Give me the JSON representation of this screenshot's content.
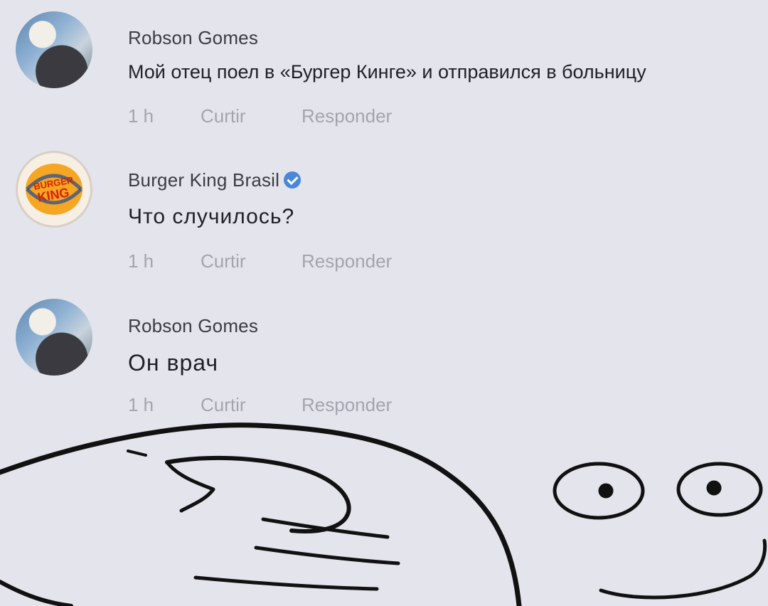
{
  "comments": [
    {
      "author": "Robson Gomes",
      "text": "Мой отец поел в «Бургер Кинге» и отправился в больницу",
      "time": "1 h",
      "like": "Curtir",
      "reply": "Responder"
    },
    {
      "author": "Burger King Brasil",
      "verified": true,
      "text": "Что случилось?",
      "time": "1 h",
      "like": "Curtir",
      "reply": "Responder",
      "logo_text_top": "BURGER",
      "logo_text_bottom": "KING"
    },
    {
      "author": "Robson Gomes",
      "text": "Он врач",
      "time": "1 h",
      "like": "Curtir",
      "reply": "Responder"
    }
  ],
  "colors": {
    "background": "#e4e5ec",
    "meta_text": "#a3a4ad",
    "verified_badge": "#4b86d8",
    "bk_red": "#d62300",
    "bk_orange": "#f5a623"
  }
}
